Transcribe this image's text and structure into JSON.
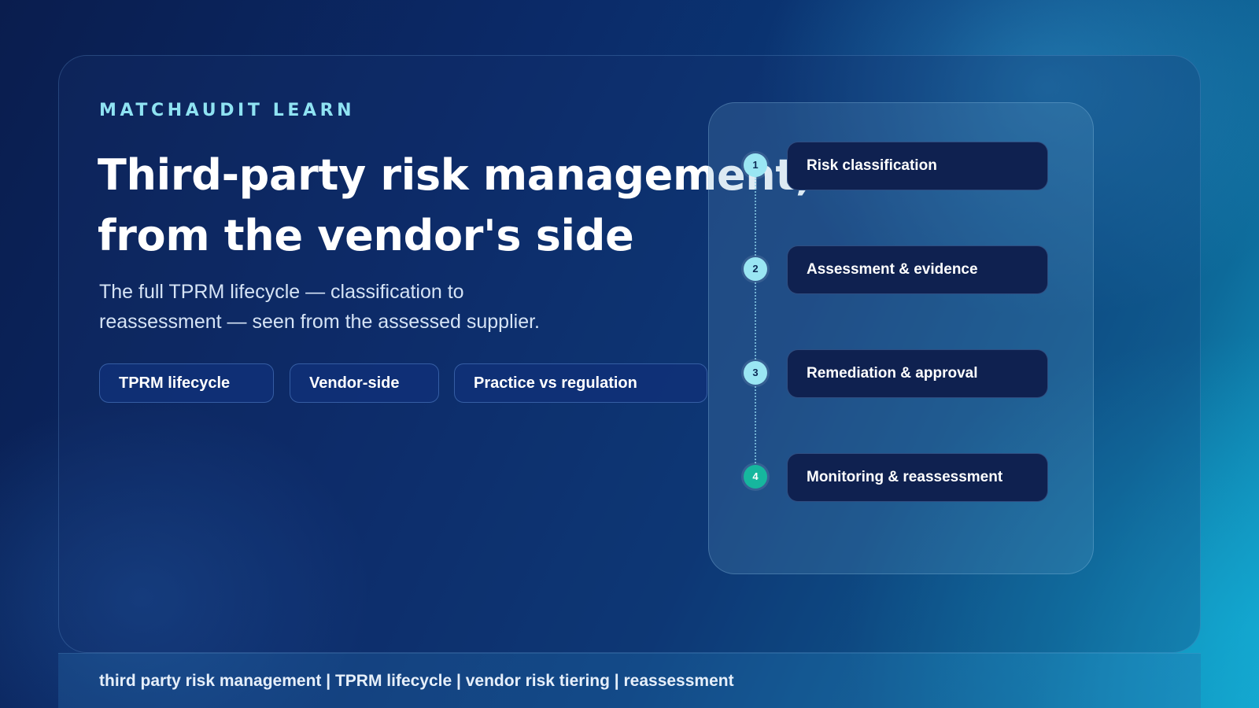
{
  "eyebrow": "MATCHAUDIT LEARN",
  "headline": {
    "line1": "Third-party risk management,",
    "line2": "from the vendor's side"
  },
  "subtitle": {
    "line1": "The full TPRM lifecycle — classification to",
    "line2": "reassessment — seen from the assessed supplier."
  },
  "tags": [
    "TPRM lifecycle",
    "Vendor-side",
    "Practice vs regulation"
  ],
  "steps": [
    {
      "number": "1",
      "label": "Risk classification"
    },
    {
      "number": "2",
      "label": "Assessment & evidence"
    },
    {
      "number": "3",
      "label": "Remediation & approval"
    },
    {
      "number": "4",
      "label": "Monitoring & reassessment"
    }
  ],
  "footer": "third party risk management | TPRM lifecycle | vendor risk tiering | reassessment",
  "colors": {
    "accent": "#8fe3f2",
    "step_dot": "#9ae6f3",
    "final_step_dot": "#16b79e",
    "step_card": "#0f2150"
  }
}
